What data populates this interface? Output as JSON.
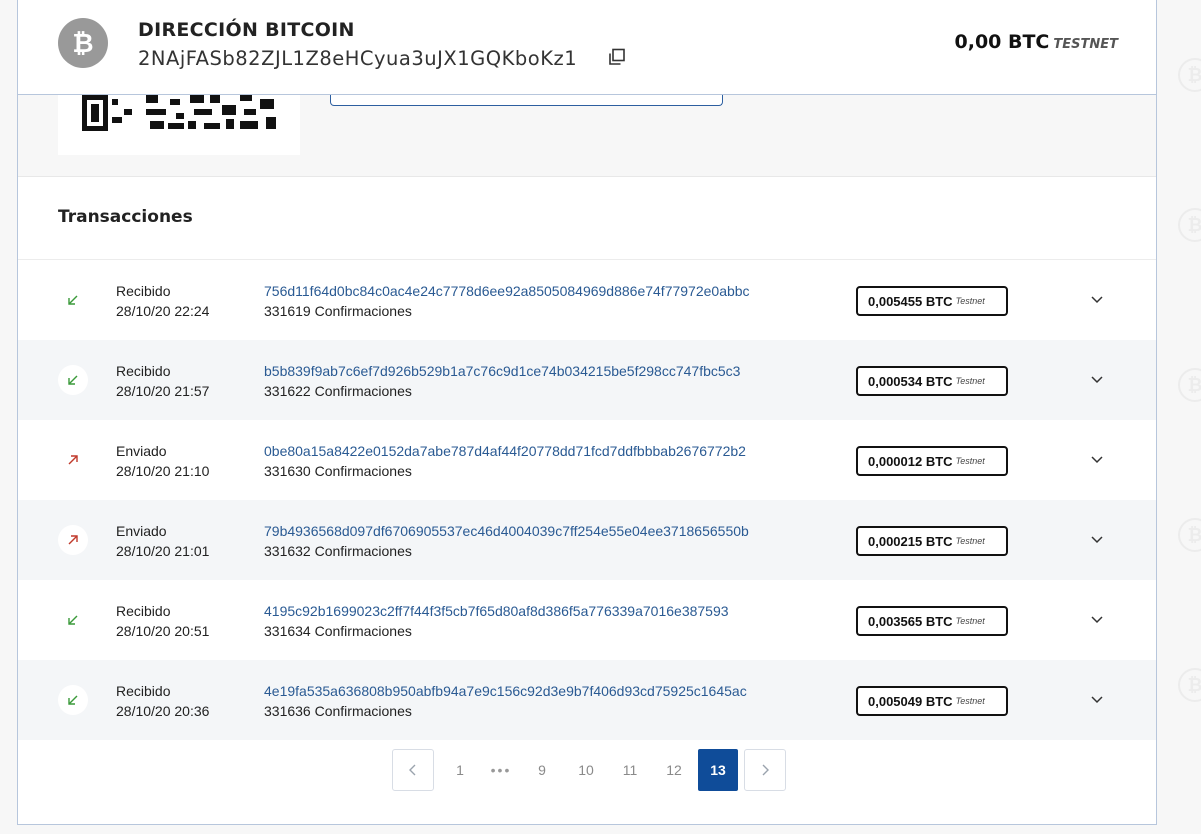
{
  "header": {
    "title": "DIRECCIÓN BITCOIN",
    "address": "2NAjFASb82ZJL1Z8eHCyua3uJX1GQKboKz1",
    "balance": "0,00 BTC",
    "network": "TESTNET",
    "coin_icon": "bitcoin-icon"
  },
  "transactions": {
    "title": "Transacciones",
    "items": [
      {
        "direction": "in",
        "type": "Recibido",
        "date": "28/10/20 22:24",
        "hash": "756d11f64d0bc84c0ac4e24c7778d6ee92a8505084969d886e74f77972e0abbc",
        "confirmations": "331619 Confirmaciones",
        "amount": "0,005455 BTC",
        "network": "Testnet"
      },
      {
        "direction": "in",
        "type": "Recibido",
        "date": "28/10/20 21:57",
        "hash": "b5b839f9ab7c6ef7d926b529b1a7c76c9d1ce74b034215be5f298cc747fbc5c3",
        "confirmations": "331622 Confirmaciones",
        "amount": "0,000534 BTC",
        "network": "Testnet"
      },
      {
        "direction": "out",
        "type": "Enviado",
        "date": "28/10/20 21:10",
        "hash": "0be80a15a8422e0152da7abe787d4af44f20778dd71fcd7ddfbbbab2676772b2",
        "confirmations": "331630 Confirmaciones",
        "amount": "0,000012 BTC",
        "network": "Testnet"
      },
      {
        "direction": "out",
        "type": "Enviado",
        "date": "28/10/20 21:01",
        "hash": "79b4936568d097df6706905537ec46d4004039c7ff254e55e04ee3718656550b",
        "confirmations": "331632 Confirmaciones",
        "amount": "0,000215 BTC",
        "network": "Testnet"
      },
      {
        "direction": "in",
        "type": "Recibido",
        "date": "28/10/20 20:51",
        "hash": "4195c92b1699023c2ff7f44f3f5cb7f65d80af8d386f5a776339a7016e387593",
        "confirmations": "331634 Confirmaciones",
        "amount": "0,003565 BTC",
        "network": "Testnet"
      },
      {
        "direction": "in",
        "type": "Recibido",
        "date": "28/10/20 20:36",
        "hash": "4e19fa535a636808b950abfb94a7e9c156c92d3e9b7f406d93cd75925c1645ac",
        "confirmations": "331636 Confirmaciones",
        "amount": "0,005049 BTC",
        "network": "Testnet"
      }
    ]
  },
  "pagination": {
    "pages": [
      "1",
      "•••",
      "9",
      "10",
      "11",
      "12",
      "13"
    ],
    "current": "13"
  },
  "colors": {
    "accent": "#0f4c99",
    "link": "#2a5a93",
    "received": "#3a9a3a",
    "sent": "#c0392b"
  }
}
